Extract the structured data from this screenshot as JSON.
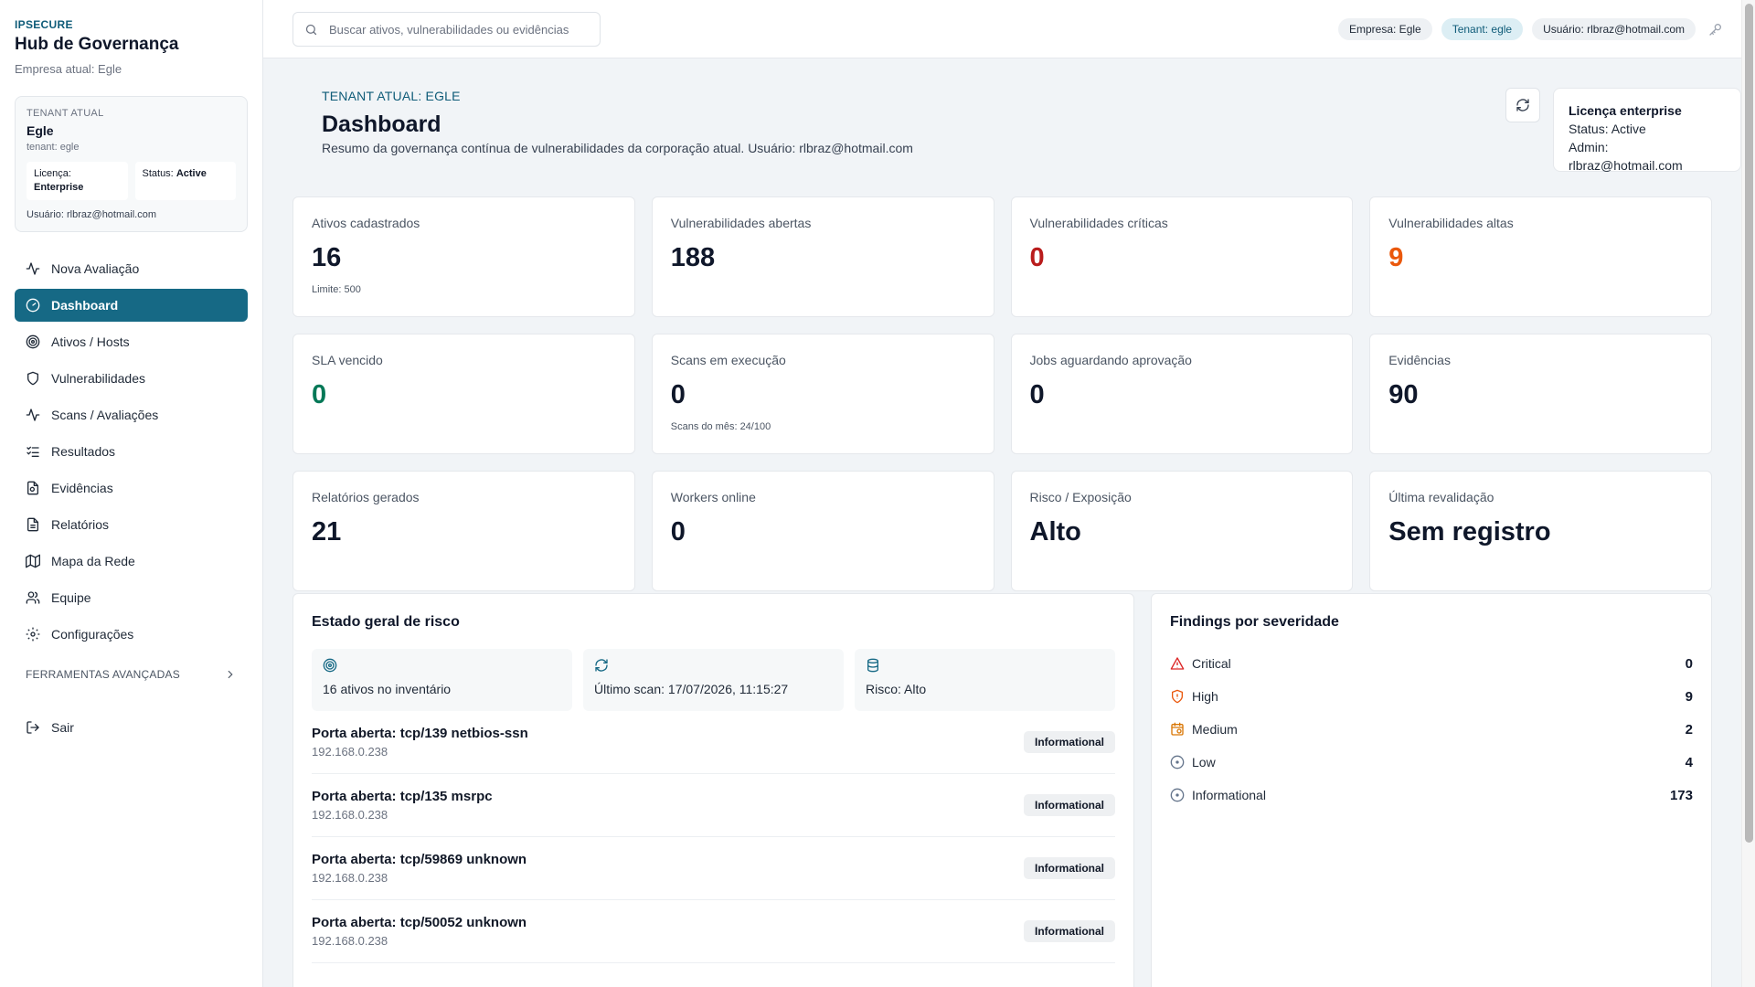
{
  "sidebar": {
    "brand_tag": "IPSECURE",
    "brand_title": "Hub de Governança",
    "company": "Empresa atual: Egle",
    "tenant_card": {
      "label": "TENANT ATUAL",
      "name": "Egle",
      "slug": "tenant: egle",
      "license_label": "Licença:",
      "license_value": "Enterprise",
      "status_label": "Status:",
      "status_value": "Active",
      "user": "Usuário: rlbraz@hotmail.com"
    },
    "nav": [
      {
        "label": "Nova Avaliação",
        "icon": "activity-icon"
      },
      {
        "label": "Dashboard",
        "icon": "gauge-icon",
        "active": true
      },
      {
        "label": "Ativos / Hosts",
        "icon": "target-icon"
      },
      {
        "label": "Vulnerabilidades",
        "icon": "shield-icon"
      },
      {
        "label": "Scans / Avaliações",
        "icon": "activity-icon"
      },
      {
        "label": "Resultados",
        "icon": "list-checks-icon"
      },
      {
        "label": "Evidências",
        "icon": "file-search-icon"
      },
      {
        "label": "Relatórios",
        "icon": "file-text-icon"
      },
      {
        "label": "Mapa da Rede",
        "icon": "map-icon"
      },
      {
        "label": "Equipe",
        "icon": "users-icon"
      },
      {
        "label": "Configurações",
        "icon": "gear-icon"
      }
    ],
    "advanced_label": "FERRAMENTAS AVANÇADAS",
    "logout_label": "Sair"
  },
  "topbar": {
    "search_placeholder": "Buscar ativos, vulnerabilidades ou evidências",
    "chip_company": "Empresa: Egle",
    "chip_tenant": "Tenant: egle",
    "chip_user": "Usuário: rlbraz@hotmail.com"
  },
  "header": {
    "eyebrow": "TENANT ATUAL: EGLE",
    "title": "Dashboard",
    "description": "Resumo da governança contínua de vulnerabilidades da corporação atual. Usuário: rlbraz@hotmail.com",
    "license": {
      "title": "Licença enterprise",
      "status": "Status: Active",
      "admin": "Admin: rlbraz@hotmail.com"
    }
  },
  "kpis": [
    {
      "label": "Ativos cadastrados",
      "value": "16",
      "sub": "Limite: 500"
    },
    {
      "label": "Vulnerabilidades abertas",
      "value": "188"
    },
    {
      "label": "Vulnerabilidades críticas",
      "value": "0"
    },
    {
      "label": "Vulnerabilidades altas",
      "value": "9"
    },
    {
      "label": "SLA vencido",
      "value": "0"
    },
    {
      "label": "Scans em execução",
      "value": "0",
      "sub": "Scans do mês: 24/100"
    },
    {
      "label": "Jobs aguardando aprovação",
      "value": "0"
    },
    {
      "label": "Evidências",
      "value": "90"
    },
    {
      "label": "Relatórios gerados",
      "value": "21"
    },
    {
      "label": "Workers online",
      "value": "0"
    },
    {
      "label": "Risco / Exposição",
      "value": "Alto"
    },
    {
      "label": "Última revalidação",
      "value": "Sem registro"
    }
  ],
  "risk": {
    "title": "Estado geral de risco",
    "stats": [
      {
        "text": "16 ativos no inventário",
        "icon": "target-icon"
      },
      {
        "text": "Último scan: 17/07/2026, 11:15:27",
        "icon": "refresh-icon"
      },
      {
        "text": "Risco: Alto",
        "icon": "database-icon"
      }
    ],
    "findings": [
      {
        "title": "Porta aberta: tcp/139 netbios-ssn",
        "ip": "192.168.0.238",
        "badge": "Informational"
      },
      {
        "title": "Porta aberta: tcp/135 msrpc",
        "ip": "192.168.0.238",
        "badge": "Informational"
      },
      {
        "title": "Porta aberta: tcp/59869 unknown",
        "ip": "192.168.0.238",
        "badge": "Informational"
      },
      {
        "title": "Porta aberta: tcp/50052 unknown",
        "ip": "192.168.0.238",
        "badge": "Informational"
      }
    ]
  },
  "severity": {
    "title": "Findings por severidade",
    "items": [
      {
        "label": "Critical",
        "count": "0",
        "icon": "alert-triangle-icon",
        "color": "#dc2626"
      },
      {
        "label": "High",
        "count": "9",
        "icon": "shield-alert-icon",
        "color": "#ea580c"
      },
      {
        "label": "Medium",
        "count": "2",
        "icon": "calendar-clock-icon",
        "color": "#d97706"
      },
      {
        "label": "Low",
        "count": "4",
        "icon": "circle-dot-icon",
        "color": "#64748b"
      },
      {
        "label": "Informational",
        "count": "173",
        "icon": "circle-dot-icon",
        "color": "#64748b"
      }
    ]
  },
  "colors": {
    "accent": "#166985",
    "critical": "#b91c1c",
    "high": "#ea580c",
    "ok": "#047857"
  }
}
